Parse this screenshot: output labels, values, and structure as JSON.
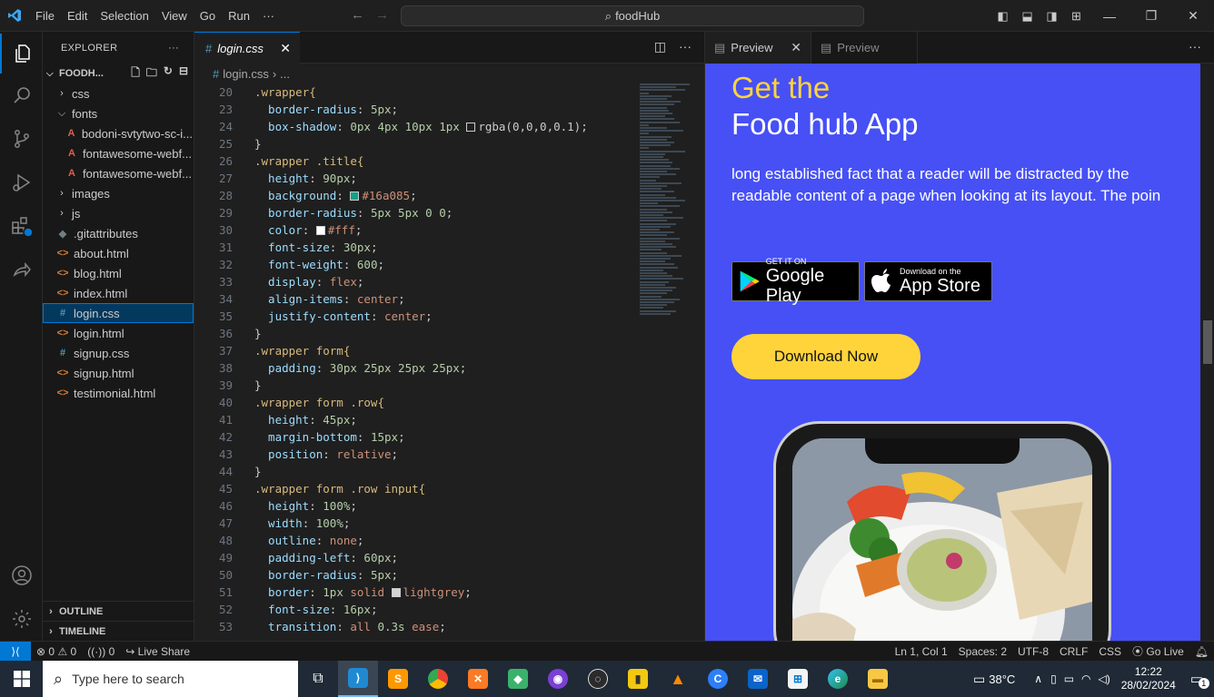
{
  "titlebar": {
    "menu": [
      "File",
      "Edit",
      "Selection",
      "View",
      "Go",
      "Run"
    ],
    "more": "···",
    "search_text": "foodHub"
  },
  "explorer": {
    "title": "EXPLORER",
    "more": "···",
    "folder": "FOODH...",
    "items": [
      {
        "label": "css",
        "kind": "folder",
        "state": "collapsed"
      },
      {
        "label": "fonts",
        "kind": "folder",
        "state": "expanded"
      },
      {
        "label": "bodoni-svtytwo-sc-i...",
        "kind": "font"
      },
      {
        "label": "fontawesome-webf...",
        "kind": "font"
      },
      {
        "label": "fontawesome-webf...",
        "kind": "font"
      },
      {
        "label": "images",
        "kind": "folder",
        "state": "collapsed"
      },
      {
        "label": "js",
        "kind": "folder",
        "state": "collapsed"
      },
      {
        "label": ".gitattributes",
        "kind": "git"
      },
      {
        "label": "about.html",
        "kind": "html"
      },
      {
        "label": "blog.html",
        "kind": "html"
      },
      {
        "label": "index.html",
        "kind": "html"
      },
      {
        "label": "login.css",
        "kind": "css",
        "selected": true
      },
      {
        "label": "login.html",
        "kind": "html"
      },
      {
        "label": "signup.css",
        "kind": "css"
      },
      {
        "label": "signup.html",
        "kind": "html"
      },
      {
        "label": "testimonial.html",
        "kind": "html"
      }
    ],
    "outline": "OUTLINE",
    "timeline": "TIMELINE"
  },
  "editor": {
    "tab_label": "login.css",
    "tab_icon": "#",
    "breadcrumb": "login.css",
    "breadcrumb_tail": "...",
    "lines": [
      {
        "n": "20",
        "t": [
          [
            "sel",
            ".wrapper{"
          ]
        ]
      },
      {
        "n": "23",
        "t": [
          [
            "prop",
            "  border-radius"
          ],
          [
            "pun",
            ": "
          ],
          [
            "num",
            "5px"
          ],
          [
            "pun",
            ";"
          ]
        ]
      },
      {
        "n": "24",
        "t": [
          [
            "prop",
            "  box-shadow"
          ],
          [
            "pun",
            ": "
          ],
          [
            "num",
            "0px 4px 10px 1px "
          ],
          [
            "swatch",
            "#1f1f1f"
          ],
          [
            "pun",
            "rgba(0,0,0,0.1);"
          ]
        ]
      },
      {
        "n": "25",
        "t": [
          [
            "pun",
            "}"
          ]
        ]
      },
      {
        "n": "26",
        "t": [
          [
            "sel",
            ".wrapper .title{"
          ]
        ]
      },
      {
        "n": "27",
        "t": [
          [
            "prop",
            "  height"
          ],
          [
            "pun",
            ": "
          ],
          [
            "num",
            "90px"
          ],
          [
            "pun",
            ";"
          ]
        ]
      },
      {
        "n": "28",
        "t": [
          [
            "prop",
            "  background"
          ],
          [
            "pun",
            ": "
          ],
          [
            "swatch",
            "#16a085"
          ],
          [
            "val",
            "#16a085"
          ],
          [
            "pun",
            ";"
          ]
        ]
      },
      {
        "n": "29",
        "t": [
          [
            "prop",
            "  border-radius"
          ],
          [
            "pun",
            ": "
          ],
          [
            "num",
            "5px 5px 0 0"
          ],
          [
            "pun",
            ";"
          ]
        ]
      },
      {
        "n": "30",
        "t": [
          [
            "prop",
            "  color"
          ],
          [
            "pun",
            ": "
          ],
          [
            "swatch",
            "#ffffff"
          ],
          [
            "val",
            "#fff"
          ],
          [
            "pun",
            ";"
          ]
        ]
      },
      {
        "n": "31",
        "t": [
          [
            "prop",
            "  font-size"
          ],
          [
            "pun",
            ": "
          ],
          [
            "num",
            "30px"
          ],
          [
            "pun",
            ";"
          ]
        ]
      },
      {
        "n": "32",
        "t": [
          [
            "prop",
            "  font-weight"
          ],
          [
            "pun",
            ": "
          ],
          [
            "num",
            "600"
          ],
          [
            "pun",
            ";"
          ]
        ]
      },
      {
        "n": "33",
        "t": [
          [
            "prop",
            "  display"
          ],
          [
            "pun",
            ": "
          ],
          [
            "val",
            "flex"
          ],
          [
            "pun",
            ";"
          ]
        ]
      },
      {
        "n": "34",
        "t": [
          [
            "prop",
            "  align-items"
          ],
          [
            "pun",
            ": "
          ],
          [
            "val",
            "center"
          ],
          [
            "pun",
            ";"
          ]
        ]
      },
      {
        "n": "35",
        "t": [
          [
            "prop",
            "  justify-content"
          ],
          [
            "pun",
            ": "
          ],
          [
            "val",
            "center"
          ],
          [
            "pun",
            ";"
          ]
        ]
      },
      {
        "n": "36",
        "t": [
          [
            "pun",
            "}"
          ]
        ]
      },
      {
        "n": "37",
        "t": [
          [
            "sel",
            ".wrapper form{"
          ]
        ]
      },
      {
        "n": "38",
        "t": [
          [
            "prop",
            "  padding"
          ],
          [
            "pun",
            ": "
          ],
          [
            "num",
            "30px 25px 25px 25px"
          ],
          [
            "pun",
            ";"
          ]
        ]
      },
      {
        "n": "39",
        "t": [
          [
            "pun",
            "}"
          ]
        ]
      },
      {
        "n": "40",
        "t": [
          [
            "sel",
            ".wrapper form .row{"
          ]
        ]
      },
      {
        "n": "41",
        "t": [
          [
            "prop",
            "  height"
          ],
          [
            "pun",
            ": "
          ],
          [
            "num",
            "45px"
          ],
          [
            "pun",
            ";"
          ]
        ]
      },
      {
        "n": "42",
        "t": [
          [
            "prop",
            "  margin-bottom"
          ],
          [
            "pun",
            ": "
          ],
          [
            "num",
            "15px"
          ],
          [
            "pun",
            ";"
          ]
        ]
      },
      {
        "n": "43",
        "t": [
          [
            "prop",
            "  position"
          ],
          [
            "pun",
            ": "
          ],
          [
            "val",
            "relative"
          ],
          [
            "pun",
            ";"
          ]
        ]
      },
      {
        "n": "44",
        "t": [
          [
            "pun",
            "}"
          ]
        ]
      },
      {
        "n": "45",
        "t": [
          [
            "sel",
            ".wrapper form .row input{"
          ]
        ]
      },
      {
        "n": "46",
        "t": [
          [
            "prop",
            "  height"
          ],
          [
            "pun",
            ": "
          ],
          [
            "num",
            "100%"
          ],
          [
            "pun",
            ";"
          ]
        ]
      },
      {
        "n": "47",
        "t": [
          [
            "prop",
            "  width"
          ],
          [
            "pun",
            ": "
          ],
          [
            "num",
            "100%"
          ],
          [
            "pun",
            ";"
          ]
        ]
      },
      {
        "n": "48",
        "t": [
          [
            "prop",
            "  outline"
          ],
          [
            "pun",
            ": "
          ],
          [
            "val",
            "none"
          ],
          [
            "pun",
            ";"
          ]
        ]
      },
      {
        "n": "49",
        "t": [
          [
            "prop",
            "  padding-left"
          ],
          [
            "pun",
            ": "
          ],
          [
            "num",
            "60px"
          ],
          [
            "pun",
            ";"
          ]
        ]
      },
      {
        "n": "50",
        "t": [
          [
            "prop",
            "  border-radius"
          ],
          [
            "pun",
            ": "
          ],
          [
            "num",
            "5px"
          ],
          [
            "pun",
            ";"
          ]
        ]
      },
      {
        "n": "51",
        "t": [
          [
            "prop",
            "  border"
          ],
          [
            "pun",
            ": "
          ],
          [
            "num",
            "1px "
          ],
          [
            "val",
            "solid "
          ],
          [
            "swatch",
            "#d3d3d3"
          ],
          [
            "val",
            "lightgrey"
          ],
          [
            "pun",
            ";"
          ]
        ]
      },
      {
        "n": "52",
        "t": [
          [
            "prop",
            "  font-size"
          ],
          [
            "pun",
            ": "
          ],
          [
            "num",
            "16px"
          ],
          [
            "pun",
            ";"
          ]
        ]
      },
      {
        "n": "53",
        "t": [
          [
            "prop",
            "  transition"
          ],
          [
            "pun",
            ": "
          ],
          [
            "val",
            "all "
          ],
          [
            "num",
            "0.3s "
          ],
          [
            "val",
            "ease"
          ],
          [
            "pun",
            ";"
          ]
        ]
      }
    ]
  },
  "preview": {
    "tab_active": "Preview",
    "tab_inactive": "Preview",
    "more": "···",
    "heading_line1": "Get the",
    "heading_line2": "Food hub App",
    "paragraph": "long established fact that a reader will be distracted by the readable content of a page when looking at its layout. The poin",
    "google_small": "GET IT ON",
    "google_big": "Google Play",
    "apple_small": "Download on the",
    "apple_big": "App Store",
    "download_button": "Download Now"
  },
  "statusbar": {
    "errors": "0",
    "warnings": "0",
    "ports": "0",
    "live_share": "Live Share",
    "position": "Ln 1, Col 1",
    "spaces": "Spaces: 2",
    "encoding": "UTF-8",
    "eol": "CRLF",
    "language": "CSS",
    "go_live": "Go Live"
  },
  "taskbar": {
    "search_placeholder": "Type here to search",
    "weather": "38°C",
    "time": "12:22",
    "date": "28/02/2024",
    "notifications": "1"
  },
  "colors": {
    "accent": "#0078d4",
    "preview_bg": "#4650f5",
    "heading_yellow": "#ffd43b"
  }
}
